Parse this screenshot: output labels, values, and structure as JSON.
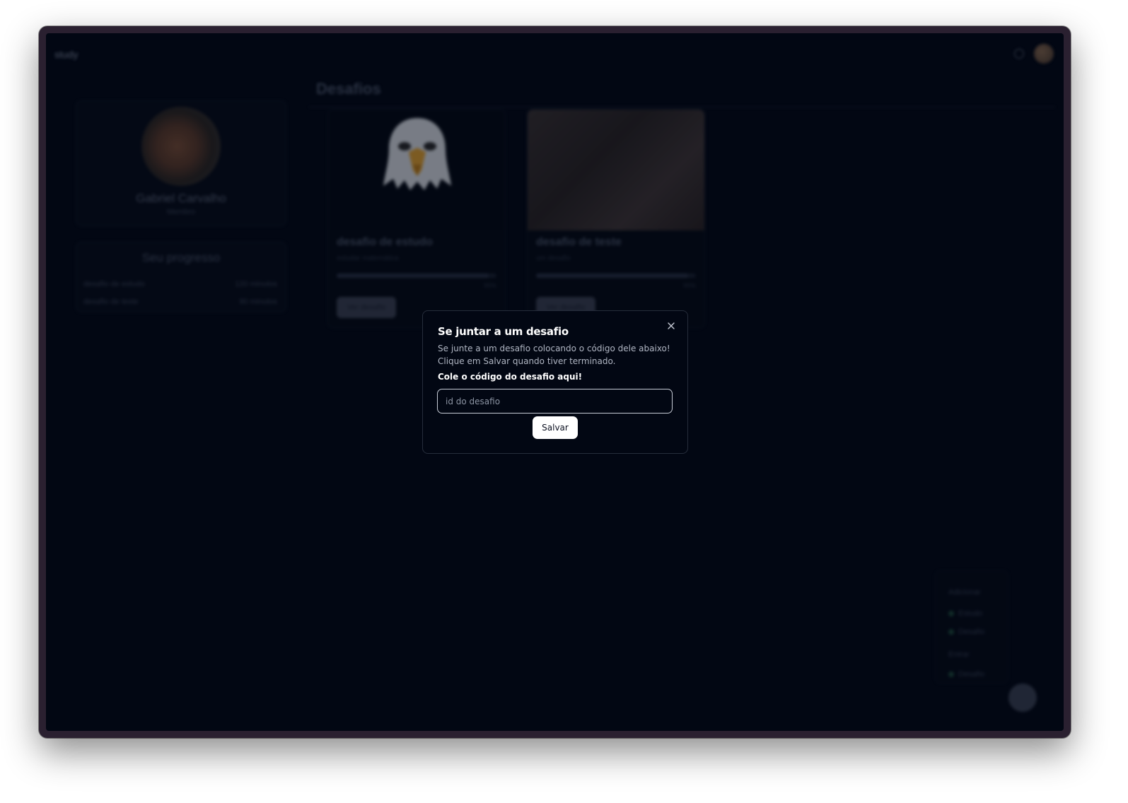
{
  "app": {
    "logo": "study",
    "page_title": "Desafios"
  },
  "profile": {
    "name": "Gabriel Carvalho",
    "subtitle": "Membro"
  },
  "progress": {
    "title": "Seu progresso",
    "rows": [
      {
        "name": "desafio de estudo",
        "value": "120 minutos"
      },
      {
        "name": "desafio de teste",
        "value": "90 minutos"
      }
    ]
  },
  "challenges": [
    {
      "title": "desafio de estudo",
      "subtitle": "estudar matemática",
      "progress": 0.95,
      "percent": "95%",
      "button": "Ver desafio"
    },
    {
      "title": "desafio de teste",
      "subtitle": "um desafio",
      "progress": 0.95,
      "percent": "95%",
      "button": "Ver desafio"
    }
  ],
  "fab_menu": {
    "section_add": "Adicionar",
    "item_study": "Estudo",
    "item_challenge": "Desafio",
    "section_enter": "Entrar",
    "item_enter_challenge": "Desafio"
  },
  "modal": {
    "title": "Se juntar a um desafio",
    "description_line1": "Se junte a um desafio colocando o código dele abaixo!",
    "description_line2": "Clique em Salvar quando tiver terminado.",
    "field_label": "Cole o código do desafio aqui!",
    "input_placeholder": "id do desafio",
    "input_value": "",
    "save_label": "Salvar",
    "close_icon": "close-icon"
  }
}
